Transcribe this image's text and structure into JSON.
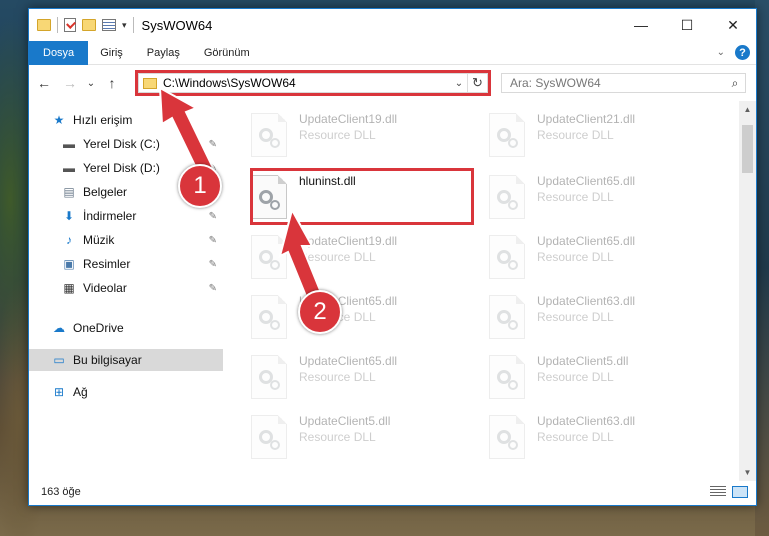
{
  "window": {
    "title": "SysWOW64",
    "controls": {
      "minimize": "—",
      "maximize": "☐",
      "close": "✕"
    }
  },
  "ribbon": {
    "tabs": [
      "Dosya",
      "Giriş",
      "Paylaş",
      "Görünüm"
    ],
    "help": "?"
  },
  "navbar": {
    "back": "←",
    "forward": "→",
    "recent": "⌄",
    "up": "↑",
    "address": "C:\\Windows\\SysWOW64",
    "refresh": "↻",
    "search_placeholder": "Ara: SysWOW64",
    "search_glyph": "⌕"
  },
  "sidebar": {
    "items": [
      {
        "label": "Hızlı erişim",
        "icon": "star-icon",
        "glyph": "★",
        "color": "#1979ca",
        "pinned": false
      },
      {
        "label": "Yerel Disk (C:)",
        "icon": "drive-icon",
        "glyph": "▬",
        "color": "#555555",
        "pinned": true
      },
      {
        "label": "Yerel Disk (D:)",
        "icon": "drive-icon",
        "glyph": "▬",
        "color": "#555555",
        "pinned": true
      },
      {
        "label": "Belgeler",
        "icon": "documents-icon",
        "glyph": "▤",
        "color": "#6a7a8a",
        "pinned": true
      },
      {
        "label": "İndirmeler",
        "icon": "downloads-icon",
        "glyph": "⬇",
        "color": "#1979ca",
        "pinned": true
      },
      {
        "label": "Müzik",
        "icon": "music-icon",
        "glyph": "♪",
        "color": "#1979ca",
        "pinned": true
      },
      {
        "label": "Resimler",
        "icon": "pictures-icon",
        "glyph": "▣",
        "color": "#4a7aaa",
        "pinned": true
      },
      {
        "label": "Videolar",
        "icon": "videos-icon",
        "glyph": "▦",
        "color": "#333333",
        "pinned": true
      },
      {
        "label": "OneDrive",
        "icon": "cloud-icon",
        "glyph": "☁",
        "color": "#1979ca",
        "pinned": false
      },
      {
        "label": "Bu bilgisayar",
        "icon": "computer-icon",
        "glyph": "▭",
        "color": "#1979ca",
        "pinned": false
      },
      {
        "label": "Ağ",
        "icon": "network-icon",
        "glyph": "⊞",
        "color": "#1979ca",
        "pinned": false
      }
    ],
    "pin_glyph": "📌"
  },
  "files": {
    "left": [
      {
        "name": "UpdateClient19.dll",
        "type": "Resource DLL"
      },
      {
        "name": "hluninst.dll",
        "type": ""
      },
      {
        "name": "UpdateClient19.dll",
        "type": "Resource DLL"
      },
      {
        "name": "UpdateClient65.dll",
        "type": "Resource DLL"
      },
      {
        "name": "UpdateClient65.dll",
        "type": "Resource DLL"
      },
      {
        "name": "UpdateClient5.dll",
        "type": "Resource DLL"
      }
    ],
    "right": [
      {
        "name": "UpdateClient21.dll",
        "type": "Resource DLL"
      },
      {
        "name": "UpdateClient65.dll",
        "type": "Resource DLL"
      },
      {
        "name": "UpdateClient65.dll",
        "type": "Resource DLL"
      },
      {
        "name": "UpdateClient63.dll",
        "type": "Resource DLL"
      },
      {
        "name": "UpdateClient5.dll",
        "type": "Resource DLL"
      },
      {
        "name": "UpdateClient63.dll",
        "type": "Resource DLL"
      }
    ]
  },
  "status": {
    "count": "163 öğe"
  },
  "annotations": {
    "step1": "1",
    "step2": "2",
    "color": "#d9353b"
  },
  "colors": {
    "accent": "#1979ca",
    "highlight": "#d9353b"
  }
}
